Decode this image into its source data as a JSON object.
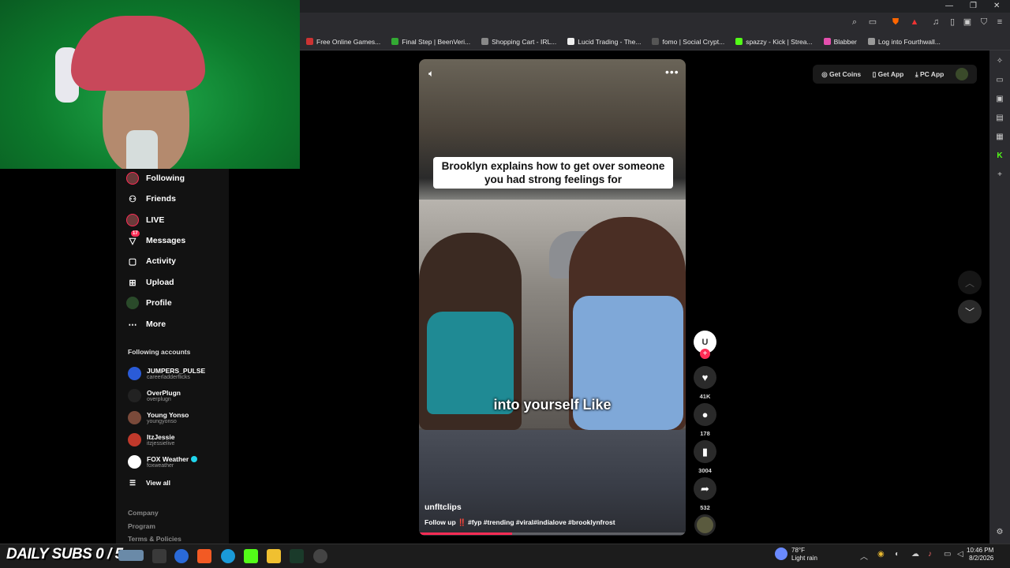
{
  "browser": {
    "window_controls": [
      "—",
      "❐",
      "✕"
    ],
    "bookmarks": [
      {
        "label": "Free Online Games...",
        "color": "#c33"
      },
      {
        "label": "Final Step | BeenVeri...",
        "color": "#3a3"
      },
      {
        "label": "Shopping Cart - IRL...",
        "color": "#888"
      },
      {
        "label": "Lucid Trading - The...",
        "color": "#eee"
      },
      {
        "label": "fomo | Social Crypt...",
        "color": "#555"
      },
      {
        "label": "spazzy - Kick | Strea...",
        "color": "#53fc18"
      },
      {
        "label": "Blabber",
        "color": "#e44fae"
      },
      {
        "label": "Log into Fourthwall...",
        "color": "#999"
      }
    ]
  },
  "sidebar": {
    "nav": [
      {
        "label": "Following",
        "icon": "following-avatar-icon"
      },
      {
        "label": "Friends",
        "icon": "friends-icon"
      },
      {
        "label": "LIVE",
        "icon": "live-icon"
      },
      {
        "label": "Messages",
        "icon": "messages-icon",
        "badge": "17"
      },
      {
        "label": "Activity",
        "icon": "activity-icon"
      },
      {
        "label": "Upload",
        "icon": "upload-icon"
      },
      {
        "label": "Profile",
        "icon": "profile-icon"
      },
      {
        "label": "More",
        "icon": "more-icon"
      }
    ],
    "following_title": "Following accounts",
    "accounts": [
      {
        "name": "JUMPERS_PULSE",
        "handle": "careerladderflicks",
        "color": "#2a5bd7",
        "verified": false
      },
      {
        "name": "OverPlugn",
        "handle": "overplugn",
        "color": "#222",
        "verified": false
      },
      {
        "name": "Young Yonso",
        "handle": "youngyonso",
        "color": "#7a4a3a",
        "verified": false
      },
      {
        "name": "ItzJessie",
        "handle": "itzjessielive",
        "color": "#c0392b",
        "verified": false
      },
      {
        "name": "FOX Weather",
        "handle": "foxweather",
        "color": "#fff",
        "verified": true
      }
    ],
    "view_all": "View all",
    "footer": [
      "Company",
      "Program",
      "Terms & Policies"
    ]
  },
  "top_buttons": {
    "get_coins": "Get Coins",
    "get_app": "Get App",
    "pc_app": "PC App"
  },
  "video": {
    "caption": "Brooklyn explains how to get over someone you had strong feelings for",
    "subtitle": "into yourself Like",
    "username": "unfltclips",
    "description": "Follow up ‼️ #fyp #trending #viral#indialove #brooklynfrost",
    "progress": 0.35,
    "creator_initial": "U"
  },
  "actions": {
    "likes": "41K",
    "comments": "178",
    "saves": "3004",
    "shares": "532"
  },
  "taskbar": {
    "subs_counter": "DAILY SUBS 0 / 5",
    "weather_temp": "78°F",
    "weather_desc": "Light rain",
    "time": "10:46 PM",
    "date": "8/2/2026"
  }
}
